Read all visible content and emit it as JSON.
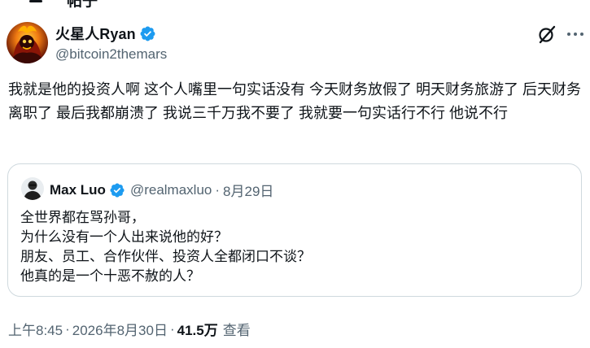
{
  "header": {
    "title": "帖子"
  },
  "tweet": {
    "author": {
      "display_name": "火星人Ryan",
      "handle": "@bitcoin2themars"
    },
    "text": "我就是他的投资人啊 这个人嘴里一句实话没有 今天财务放假了 明天财务旅游了 后天财务离职了 最后我都崩溃了 我说三千万我不要了 我就要一句实话行不行 他说不行",
    "meta": {
      "time": "上午8:45",
      "separator": "·",
      "date": "2026年8月30日",
      "views_count": "41.5万",
      "views_label": "查看"
    }
  },
  "quote": {
    "author": {
      "display_name": "Max Luo",
      "handle": "@realmaxluo"
    },
    "separator": "·",
    "date": "8月29日",
    "lines": [
      "全世界都在骂孙哥，",
      "为什么没有一个人出来说他的好？",
      "朋友、员工、合作伙伴、投资人全都闭口不谈？",
      "他真的是一个十恶不赦的人？"
    ]
  },
  "colors": {
    "text_primary": "#0f1419",
    "text_secondary": "#536471",
    "verified_blue": "#1d9bf0",
    "border": "#cfd9de"
  },
  "icons": {
    "verified": "verified-badge-icon",
    "grok": "grok-icon",
    "more": "more-options-icon"
  }
}
